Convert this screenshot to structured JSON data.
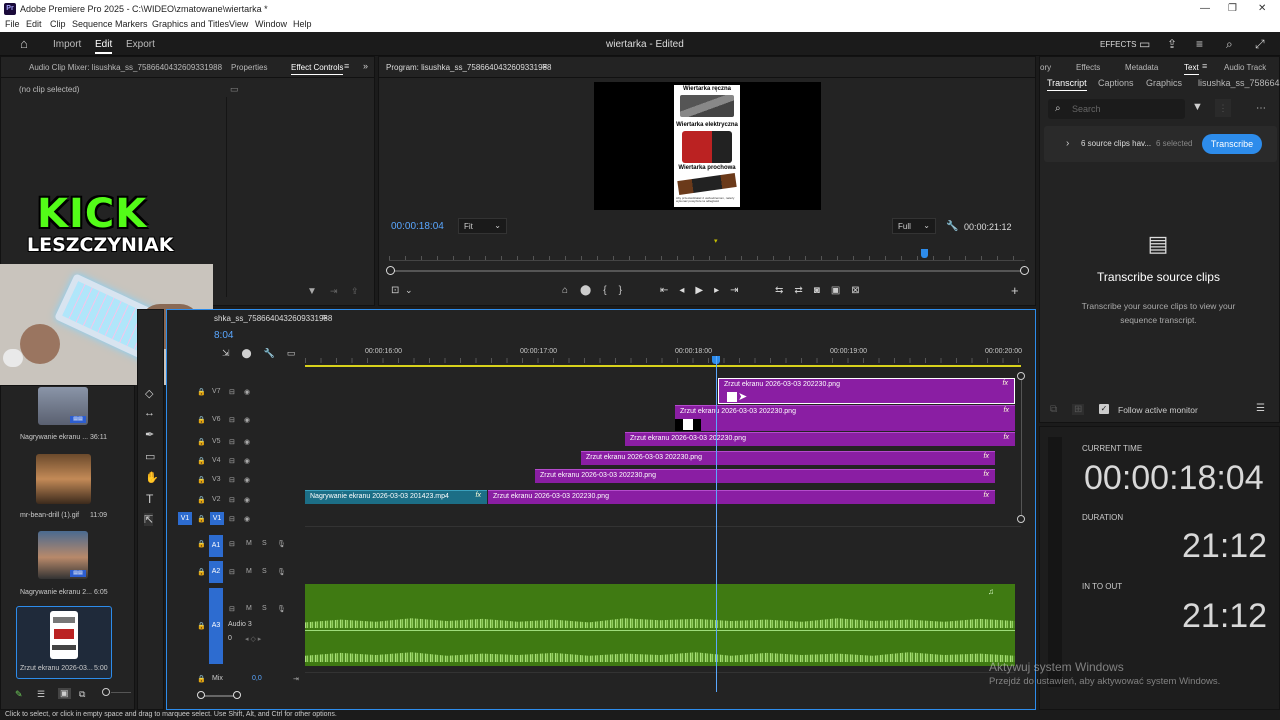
{
  "window": {
    "title": "Adobe Premiere Pro 2025 - C:\\WIDEO\\zmatowane\\wiertarka *",
    "app_icon": "Pr"
  },
  "menu": [
    "File",
    "Edit",
    "Clip",
    "Sequence",
    "Markers",
    "Graphics and Titles",
    "View",
    "Window",
    "Help"
  ],
  "workspace": {
    "home_icon": "home-icon",
    "tabs": [
      "Import",
      "Edit",
      "Export"
    ],
    "active_tab": "Edit",
    "project_title": "wiertarka - Edited",
    "effects_label": "EFFECTS"
  },
  "left_panel": {
    "tabs": [
      "Audio Clip Mixer: lisushka_ss_7586640432609331988",
      "Properties",
      "Effect Controls"
    ],
    "active_tab": "Effect Controls",
    "no_clip": "(no clip selected)"
  },
  "overlay": {
    "kick": "KICK",
    "name": "LESZCZYNIAK"
  },
  "program_monitor": {
    "title": "Program: lisushka_ss_7586640432609331988",
    "timecode": "00:00:18:04",
    "fit": "Fit",
    "quality": "Full",
    "duration": "00:00:21:12",
    "image_lines": [
      "Wiertarka ręczna",
      "Wiertarka elektryczna",
      "Wiertarka prochowa"
    ],
    "image_footer": "Aby przeciwdziałać 2 uszkodzeniom, należy wykonać powyższe ta odległości"
  },
  "right_panel": {
    "tabs": [
      "ory",
      "Effects",
      "Metadata",
      "Text",
      "Audio Track"
    ],
    "active_tab": "Text",
    "subtabs": [
      "Transcript",
      "Captions",
      "Graphics",
      "lisushka_ss_758664"
    ],
    "active_subtab": "Transcript",
    "search_placeholder": "Search",
    "source_clips": "6 source clips hav...",
    "selected": "6 selected",
    "transcribe_button": "Transcribe",
    "heading": "Transcribe source clips",
    "description": "Transcribe your source clips to view your sequence transcript.",
    "follow_label": "Follow active monitor"
  },
  "time_panel": {
    "current_label": "CURRENT TIME",
    "current": "00:00:18:04",
    "duration_label": "DURATION",
    "duration": "21:12",
    "inout_label": "IN TO OUT",
    "inout": "21:12"
  },
  "project_bin": {
    "items": [
      {
        "name": "Nagrywanie ekranu ...",
        "dur": "36:11"
      },
      {
        "name": "mr-bean-drill (1).gif",
        "dur": "11:09"
      },
      {
        "name": "Nagrywanie ekranu 2...",
        "dur": "6:05"
      },
      {
        "name": "Zrzut ekranu 2026-03...",
        "dur": "5:00"
      }
    ]
  },
  "timeline": {
    "sequence": "shka_ss_7586640432609331988",
    "timecode_partial": "8:04",
    "ruler": [
      "00:00:16:00",
      "00:00:17:00",
      "00:00:18:00",
      "00:00:19:00",
      "00:00:20:00"
    ],
    "video_tracks": [
      "V7",
      "V6",
      "V5",
      "V4",
      "V3",
      "V2",
      "V1"
    ],
    "audio_tracks": [
      "A1",
      "A2",
      "A3"
    ],
    "audio3_name": "Audio 3",
    "audio3_level": "0",
    "mix_label": "Mix",
    "mix_value": "0,0",
    "clips": {
      "v7": "Zrzut ekranu 2026-03-03 202230.png",
      "v6": "Zrzut ekranu 2026-03-03 202230.png",
      "v5": "Zrzut ekranu 2026-03-03 202230.png",
      "v4": "Zrzut ekranu 2026-03-03 202230.png",
      "v3": "Zrzut ekranu 2026-03-03 202230.png",
      "v2a": "Nagrywanie ekranu 2026-03-03 201423.mp4",
      "v2b": "Zrzut ekranu 2026-03-03 202230.png"
    },
    "fx": "fx",
    "track_ctl": {
      "m": "M",
      "s": "S"
    }
  },
  "status_bar": "Click to select, or click in empty space and drag to marquee select. Use Shift, Alt, and Ctrl for other options.",
  "watermark": {
    "line1": "Aktywuj system Windows",
    "line2": "Przejdź do ustawień, aby aktywować system Windows."
  },
  "colors": {
    "accent_blue": "#2d8ceb",
    "clip_purple": "#8a1ea3",
    "clip_teal": "#1c6e86",
    "audio_green": "#3f7a12",
    "kick_green": "#53fc18",
    "timecode_blue": "#5aa7ff"
  }
}
